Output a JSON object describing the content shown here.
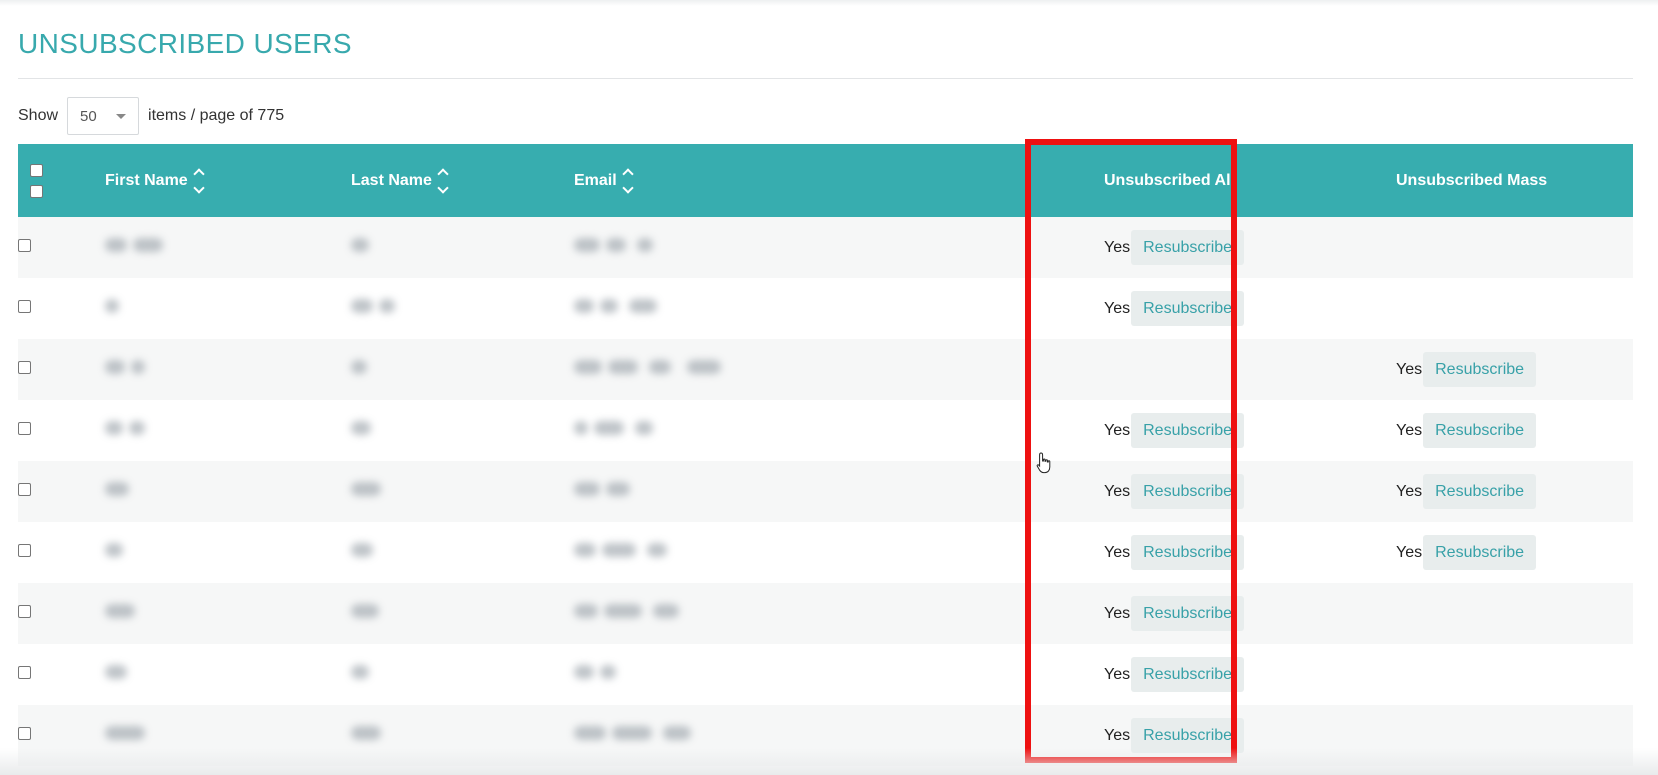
{
  "page": {
    "title": "UNSUBSCRIBED USERS"
  },
  "pager": {
    "show_label": "Show",
    "page_size": "50",
    "suffix": "items / page of 775"
  },
  "table": {
    "columns": {
      "first_name": "First Name",
      "last_name": "Last Name",
      "email": "Email",
      "unsubscribed_all": "Unsubscribed All",
      "unsubscribed_mass": "Unsubscribed Mass"
    },
    "yes_label": "Yes",
    "resubscribe_label": "Resubscribe",
    "rows": [
      {
        "unsubscribed_all": true,
        "unsubscribed_mass": false
      },
      {
        "unsubscribed_all": true,
        "unsubscribed_mass": false
      },
      {
        "unsubscribed_all": false,
        "unsubscribed_mass": true
      },
      {
        "unsubscribed_all": true,
        "unsubscribed_mass": true
      },
      {
        "unsubscribed_all": true,
        "unsubscribed_mass": true
      },
      {
        "unsubscribed_all": true,
        "unsubscribed_mass": true
      },
      {
        "unsubscribed_all": true,
        "unsubscribed_mass": false
      },
      {
        "unsubscribed_all": true,
        "unsubscribed_mass": false
      },
      {
        "unsubscribed_all": true,
        "unsubscribed_mass": false
      }
    ]
  },
  "colors": {
    "accent": "#38a9ad",
    "header_bg": "#37adaf",
    "highlight": "#ee1111",
    "button_bg": "#e8eded"
  },
  "icons": {
    "sort": "sort-icon",
    "dropdown": "chevron-down-icon",
    "cursor": "hand-pointer-icon"
  }
}
